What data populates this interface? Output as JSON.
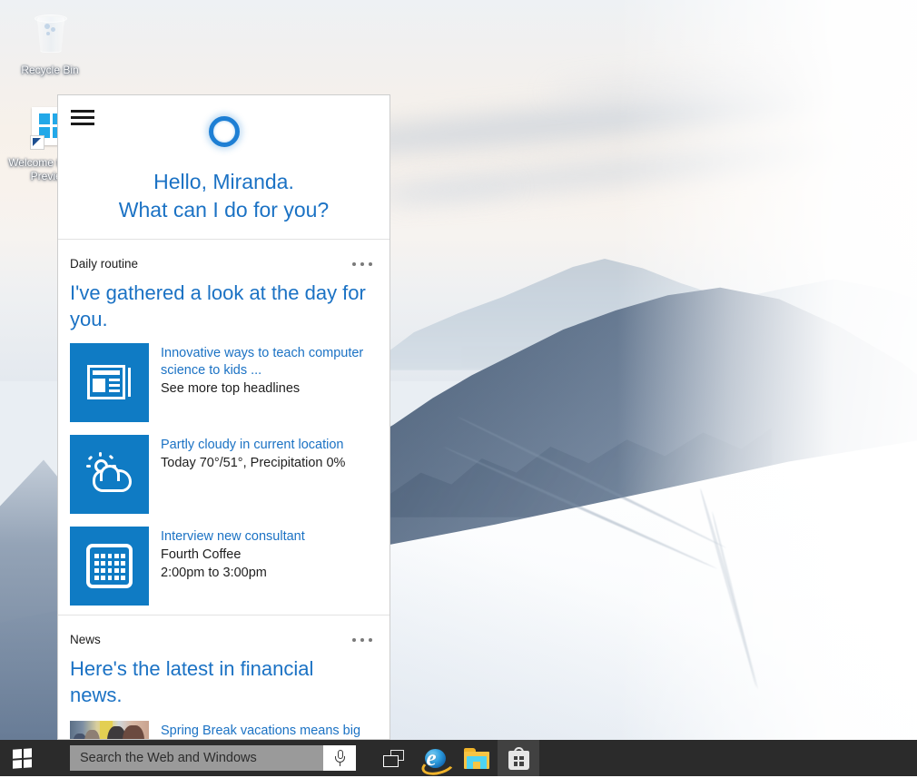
{
  "desktop": {
    "icons": [
      {
        "name": "recycle-bin",
        "label": "Recycle Bin",
        "icon": "recycle-bin-icon"
      },
      {
        "name": "welcome-tech-preview",
        "label": "Welcome to\nTech Preview",
        "label_line1": "Welcome to",
        "label_line2": "Tech Preview",
        "icon": "windows-shortcut-icon"
      }
    ]
  },
  "cortana": {
    "menu_icon": "hamburger-menu-icon",
    "avatar_icon": "cortana-ring-icon",
    "greeting_line1": "Hello, Miranda.",
    "greeting_line2": "What can I do for you?",
    "accent_color": "#1b72c4",
    "tile_color": "#0f7bc4",
    "sections": [
      {
        "id": "daily-routine",
        "title": "Daily routine",
        "overflow_icon": "more-options-icon",
        "lead": "I've gathered a look at the day for you.",
        "items": [
          {
            "id": "news-headlines",
            "icon": "newspaper-icon",
            "title": "Innovative ways to teach computer science to kids ...",
            "subtitle": "See more top headlines"
          },
          {
            "id": "weather",
            "icon": "partly-cloudy-icon",
            "title": "Partly cloudy in current location",
            "subtitle": "Today 70°/51°, Precipitation 0%"
          },
          {
            "id": "calendar-event",
            "icon": "calendar-icon",
            "title": "Interview new consultant",
            "subtitle": "Fourth Coffee",
            "subtitle2": "2:00pm to 3:00pm"
          }
        ]
      },
      {
        "id": "news",
        "title": "News",
        "overflow_icon": "more-options-icon",
        "lead": "Here's the latest in financial news.",
        "items": [
          {
            "id": "spring-break-story",
            "icon": "news-photo-thumbnail",
            "title": "Spring Break vacations means big business"
          }
        ]
      }
    ]
  },
  "taskbar": {
    "start_button": {
      "name": "start-button",
      "icon": "windows-logo-icon"
    },
    "search": {
      "placeholder": "Search the Web and Windows",
      "value": "",
      "mic_icon": "microphone-icon"
    },
    "buttons": [
      {
        "id": "task-view",
        "icon": "task-view-icon",
        "active": false
      },
      {
        "id": "internet-explorer",
        "icon": "internet-explorer-icon",
        "active": false
      },
      {
        "id": "file-explorer",
        "icon": "file-explorer-icon",
        "active": false
      },
      {
        "id": "store",
        "icon": "store-icon",
        "active": true
      }
    ]
  }
}
